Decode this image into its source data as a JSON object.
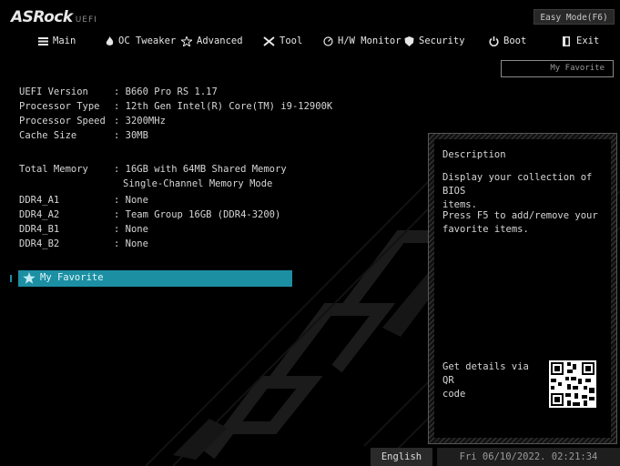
{
  "header": {
    "logo": "ASRock",
    "logo_sub": "UEFI",
    "easy_mode_label": "Easy Mode(F6)"
  },
  "menu": [
    {
      "label": "Main",
      "icon": "list-icon"
    },
    {
      "label": "OC Tweaker",
      "icon": "flame-icon"
    },
    {
      "label": "Advanced",
      "icon": "star-icon"
    },
    {
      "label": "Tool",
      "icon": "wrench-icon"
    },
    {
      "label": "H/W Monitor",
      "icon": "monitor-icon"
    },
    {
      "label": "Security",
      "icon": "shield-icon"
    },
    {
      "label": "Boot",
      "icon": "power-icon"
    },
    {
      "label": "Exit",
      "icon": "exit-icon"
    }
  ],
  "my_favorite_button": "My Favorite",
  "info": {
    "uefi_version": {
      "label": "UEFI Version",
      "value": ": B660 Pro RS 1.17"
    },
    "processor_type": {
      "label": "Processor Type",
      "value": ": 12th Gen Intel(R) Core(TM) i9-12900K"
    },
    "processor_speed": {
      "label": "Processor Speed",
      "value": ": 3200MHz"
    },
    "cache_size": {
      "label": "Cache Size",
      "value": ": 30MB"
    },
    "total_memory": {
      "label": "Total Memory",
      "value": ": 16GB with 64MB Shared Memory"
    },
    "memory_mode": "Single-Channel Memory Mode",
    "ddr4_a1": {
      "label": "DDR4_A1",
      "value": ": None"
    },
    "ddr4_a2": {
      "label": "DDR4_A2",
      "value": ": Team Group 16GB (DDR4-3200)"
    },
    "ddr4_b1": {
      "label": "DDR4_B1",
      "value": ": None"
    },
    "ddr4_b2": {
      "label": "DDR4_B2",
      "value": ": None"
    }
  },
  "favorite_item": "My Favorite",
  "description": {
    "title": "Description",
    "text1": "Display your collection of BIOS\nitems.",
    "text2": "Press F5 to add/remove your\nfavorite items.",
    "qr_text": "Get details via QR\ncode"
  },
  "footer": {
    "language": "English",
    "datetime": "Fri 06/10/2022. 02:21:34"
  },
  "colors": {
    "accent": "#1c8fa3",
    "background": "#000000"
  }
}
